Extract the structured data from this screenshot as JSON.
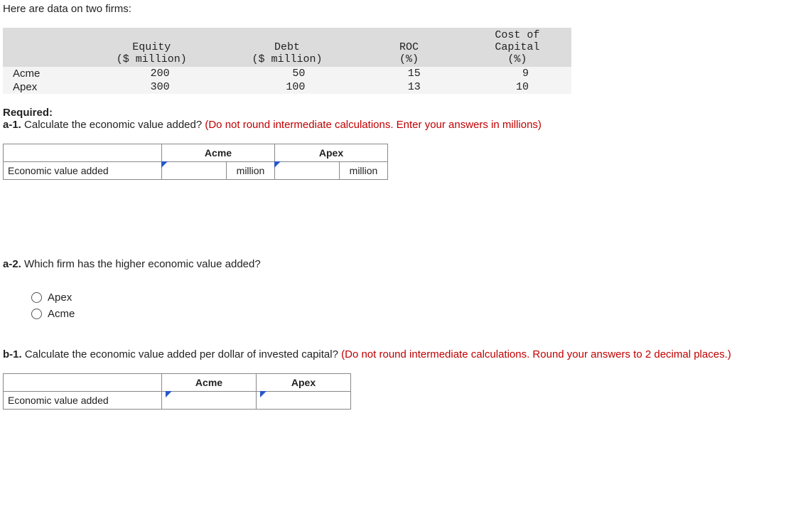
{
  "intro": "Here are data on two firms:",
  "headers": {
    "equity": "Equity\n($ million)",
    "debt": "Debt\n($ million)",
    "roc": "ROC\n(%)",
    "coc": "Cost of\nCapital\n(%)"
  },
  "rows": [
    {
      "name": "Acme",
      "equity": "200",
      "debt": "50",
      "roc": "15",
      "coc": "9"
    },
    {
      "name": "Apex",
      "equity": "300",
      "debt": "100",
      "roc": "13",
      "coc": "10"
    }
  ],
  "required_label": "Required:",
  "a1": {
    "label": "a-1. ",
    "text": "Calculate the economic value added? ",
    "note": "(Do not round intermediate calculations. Enter your answers in millions)"
  },
  "answer": {
    "row_label": "Economic value added",
    "col1": "Acme",
    "col2": "Apex",
    "unit": "million"
  },
  "a2": {
    "label": "a-2. ",
    "text": "Which firm has the higher economic value added?"
  },
  "options": [
    "Apex",
    "Acme"
  ],
  "b1": {
    "label": "b-1. ",
    "text": "Calculate the economic value added per dollar of invested capital? ",
    "note": "(Do not round intermediate calculations. Round your answers to 2 decimal places.)"
  }
}
